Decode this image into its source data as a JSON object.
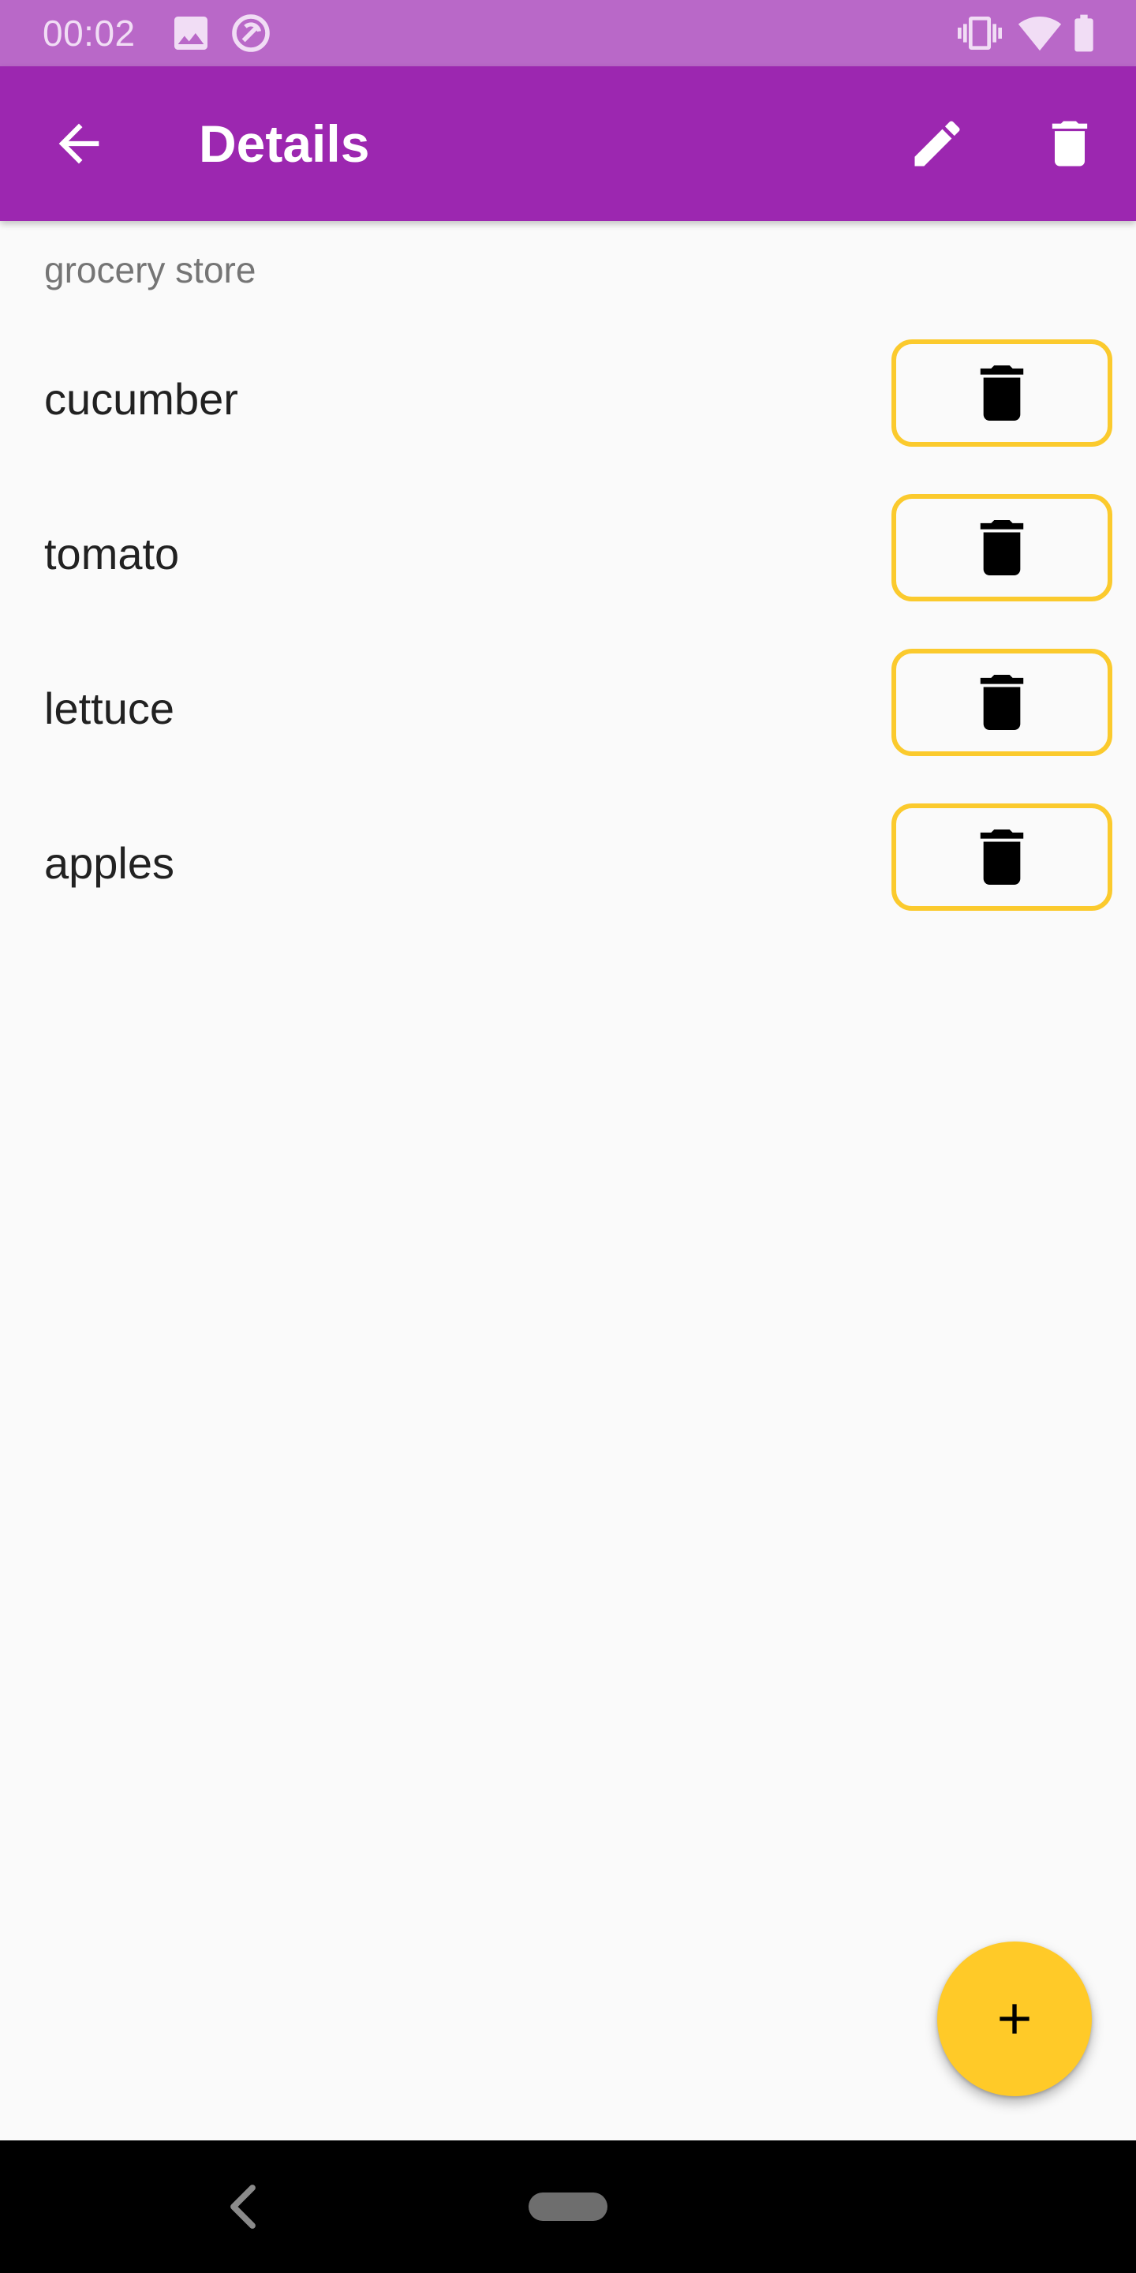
{
  "status_bar": {
    "time": "00:02",
    "icons": [
      "image-icon",
      "sync-icon",
      "vibrate-icon",
      "wifi-icon",
      "battery-icon"
    ]
  },
  "app_bar": {
    "title": "Details",
    "background_color": "#9C27B0",
    "icons": [
      "back-arrow-icon",
      "edit-pencil-icon",
      "delete-trash-icon"
    ]
  },
  "list": {
    "heading": "grocery store",
    "accent_color": "#FBCA2D",
    "items": [
      {
        "label": "cucumber"
      },
      {
        "label": "tomato"
      },
      {
        "label": "lettuce"
      },
      {
        "label": "apples"
      }
    ]
  },
  "fab": {
    "icon": "plus-icon",
    "color": "#FFCA28"
  },
  "nav_bar": {
    "icons": [
      "nav-back-icon",
      "nav-home-pill"
    ]
  }
}
